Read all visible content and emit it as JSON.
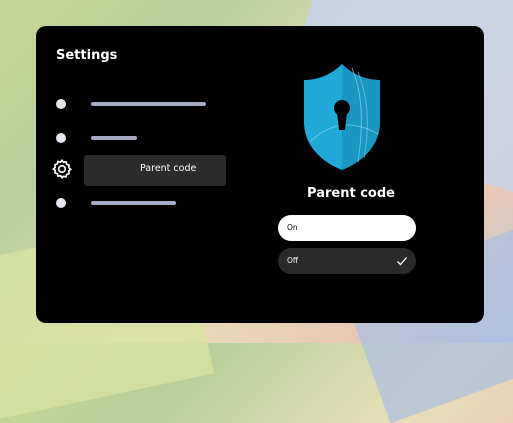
{
  "settings": {
    "title": "Settings",
    "menu": [
      {
        "icon": "dot"
      },
      {
        "icon": "dot"
      },
      {
        "icon": "gear-icon",
        "label": "Parent code",
        "selected": true
      },
      {
        "icon": "dot"
      }
    ]
  },
  "detail": {
    "title": "Parent code",
    "options": [
      {
        "label": "On",
        "selected": false
      },
      {
        "label": "Off",
        "selected": true
      }
    ]
  },
  "colors": {
    "panel": "#000000",
    "shield": "#21a9d8",
    "selected_row": "#2b2b2b"
  }
}
